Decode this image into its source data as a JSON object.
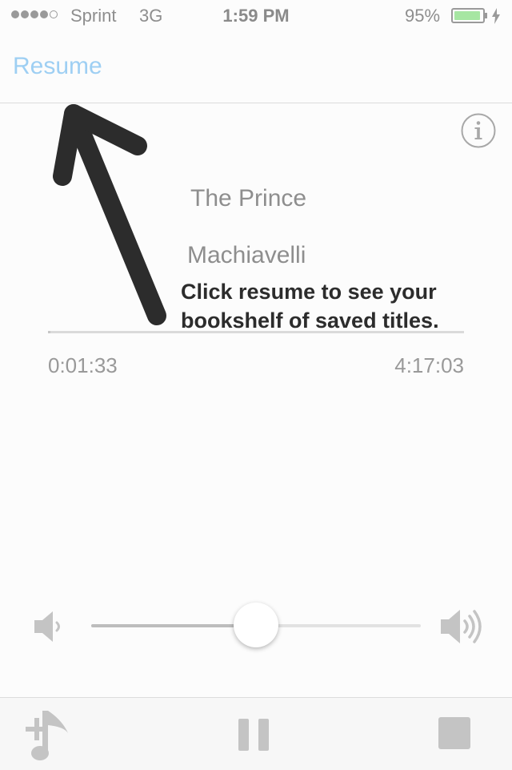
{
  "status_bar": {
    "carrier": "Sprint",
    "network": "3G",
    "time": "1:59 PM",
    "battery_percent": "95%",
    "battery_level": 0.95,
    "signal_bars_filled": 4,
    "signal_bars_total": 5
  },
  "nav": {
    "resume_label": "Resume"
  },
  "book": {
    "title": "The Prince",
    "author": "Machiavelli"
  },
  "tooltip": {
    "line1": "Click resume to see your",
    "line2": "bookshelf of saved titles."
  },
  "playback": {
    "elapsed": "0:01:33",
    "total": "4:17:03",
    "progress": 0.006
  },
  "volume": {
    "level": 0.5
  },
  "icons": {
    "info": "info-icon",
    "volume_low": "volume-low-icon",
    "volume_high": "volume-high-icon",
    "add_music": "add-music-icon",
    "pause": "pause-icon",
    "stop": "stop-icon",
    "arrow": "pointer-arrow"
  },
  "colors": {
    "accent": "#9ecff3",
    "battery": "#a6e6a2",
    "tooltip_text": "#2c2c2c",
    "arrow": "#2c2c2c"
  }
}
